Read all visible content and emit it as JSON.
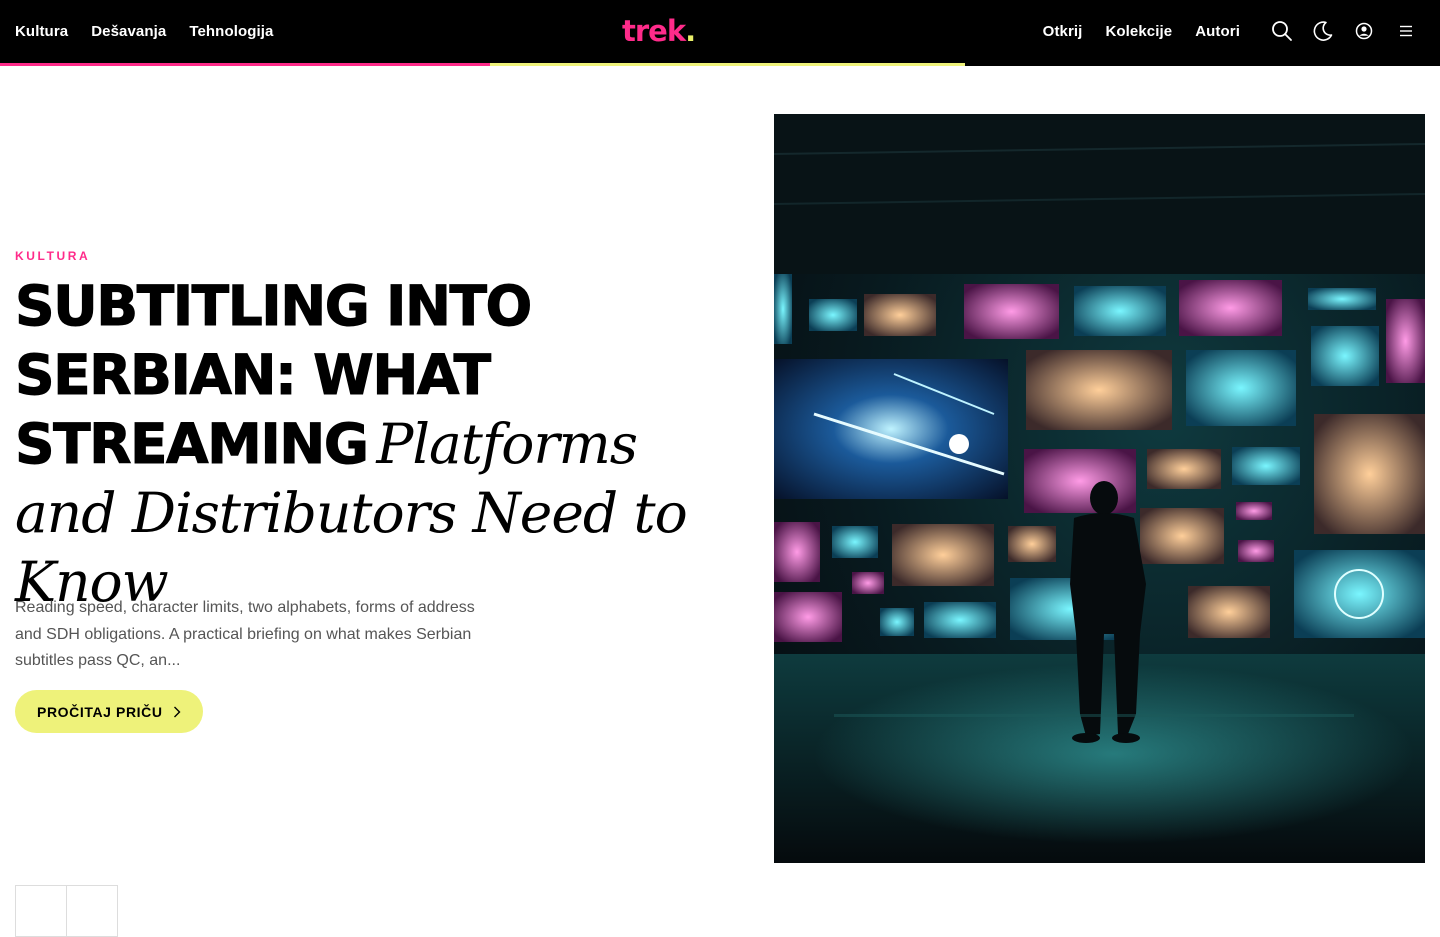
{
  "header": {
    "nav_left": [
      "Kultura",
      "Dešavanja",
      "Tehnologija"
    ],
    "logo": {
      "text": "trek",
      "dot": "."
    },
    "nav_right": [
      "Otkrij",
      "Kolekcije",
      "Autori"
    ],
    "icons": [
      "search-icon",
      "moon-icon",
      "user-icon",
      "menu-icon"
    ],
    "progress": 0.67
  },
  "hero": {
    "category": "KULTURA",
    "title_bold": "SUBTITLING INTO SERBIAN: WHAT STREAMING",
    "title_italic": "Platforms and Distributors Need to Know",
    "summary": "Reading speed, character limits, two alphabets, forms of address and SDH obligations. A practical briefing on what makes Serbian subtitles pass QC, an...",
    "cta": "PROČITAJ PRIČU"
  },
  "colors": {
    "accent_pink": "#ff2b8a",
    "accent_yellow": "#eef27a",
    "header_bg": "#000000"
  }
}
